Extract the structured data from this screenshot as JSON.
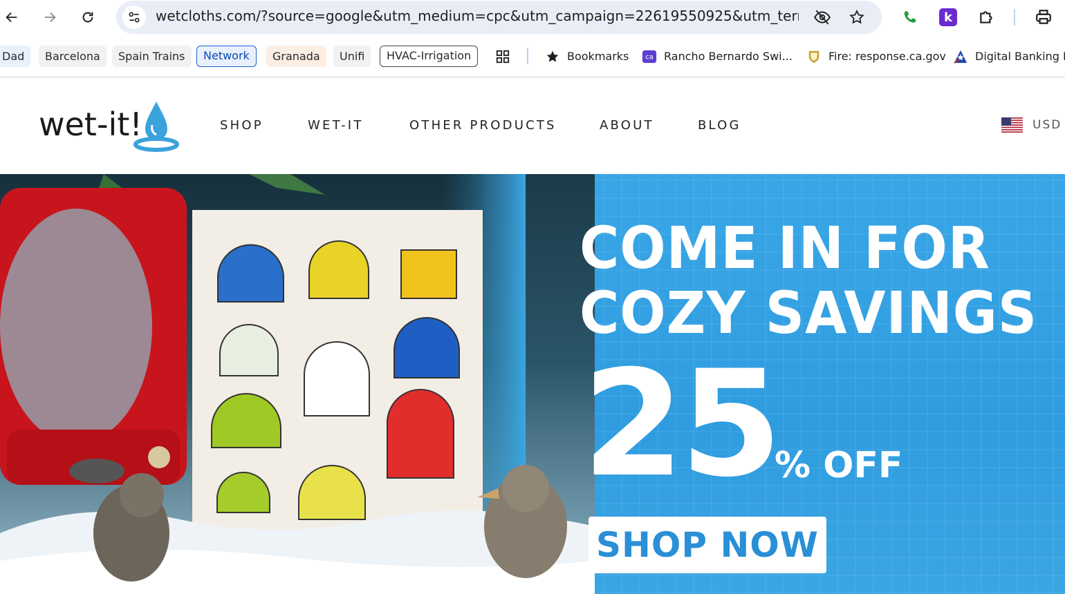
{
  "browser": {
    "url": "wetcloths.com/?source=google&utm_medium=cpc&utm_campaign=22619550925&utm_term=...",
    "bookmark_chips": [
      {
        "label": "Dad",
        "style": "blue-fill"
      },
      {
        "label": "Barcelona",
        "style": "gray-fill"
      },
      {
        "label": "Spain Trains",
        "style": "gray-fill"
      },
      {
        "label": "Network",
        "style": "blue-outline"
      },
      {
        "label": "Granada",
        "style": "peach-fill"
      },
      {
        "label": "Unifi",
        "style": "gray-fill"
      },
      {
        "label": "HVAC-Irrigation",
        "style": "outlined"
      }
    ],
    "bookmarks": [
      {
        "label": "Bookmarks",
        "icon": "star-icon"
      },
      {
        "label": "Rancho Bernardo Swi...",
        "icon": "ca-favicon"
      },
      {
        "label": "Fire: response.ca.gov",
        "icon": "ca-seal-favicon"
      },
      {
        "label": "Digital Banking Lo",
        "icon": "bank-favicon"
      }
    ]
  },
  "site": {
    "logo_text": "wet-it!",
    "nav": [
      "SHOP",
      "WET-IT",
      "OTHER PRODUCTS",
      "ABOUT",
      "BLOG"
    ],
    "currency": "USD"
  },
  "hero": {
    "headline_line1": "COME IN FOR",
    "headline_line2": "COZY SAVINGS",
    "discount_number": "25",
    "discount_suffix": "% OFF",
    "cta": "SHOP NOW",
    "colors": {
      "background": "#3aa0de",
      "cta_text": "#2a8fd6"
    }
  }
}
